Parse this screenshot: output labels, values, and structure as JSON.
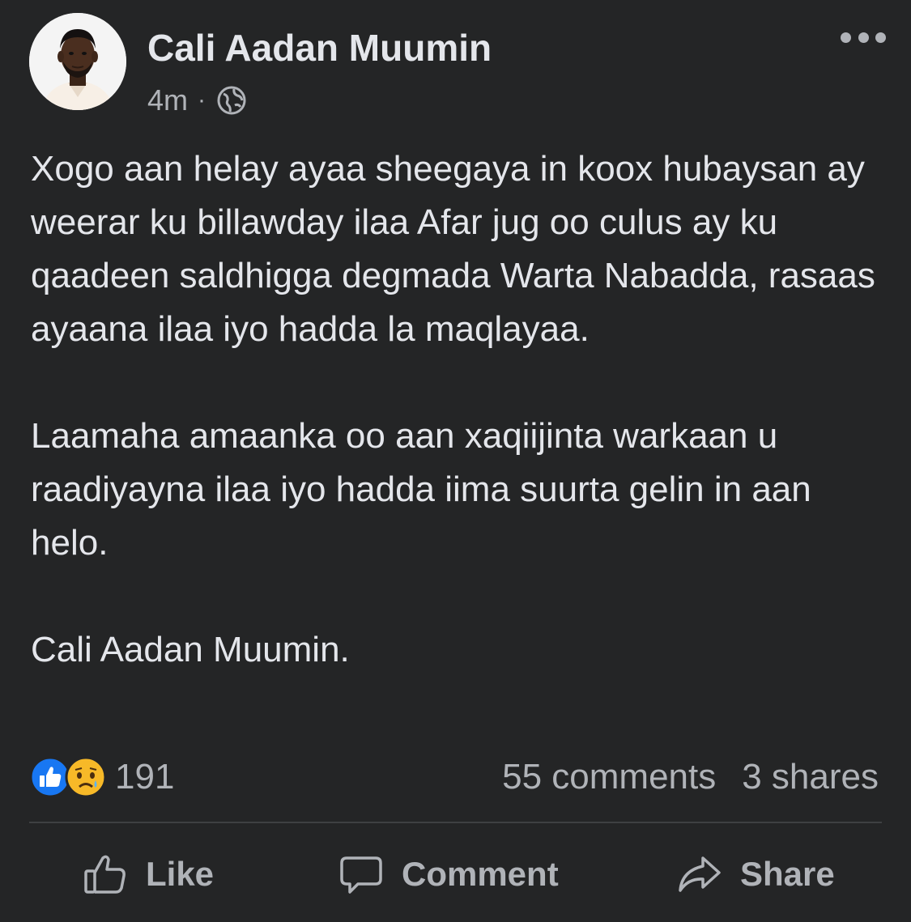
{
  "post": {
    "author": "Cali Aadan Muumin",
    "time": "4m",
    "separator": "·",
    "audience_icon": "globe-icon",
    "more_icon": "more-options-icon",
    "paragraphs": [
      "Xogo aan helay ayaa sheegaya in koox hubaysan ay weerar ku billawday ilaa Afar jug oo culus ay ku qaadeen saldhigga degmada Warta Nabadda, rasaas ayaana ilaa iyo hadda la maqlayaa.",
      "Laamaha amaanka oo aan xaqiijinta warkaan u raadiyayna ilaa iyo hadda iima suurta gelin in aan helo.",
      "Cali Aadan Muumin."
    ]
  },
  "stats": {
    "reaction_icons": [
      "like-reaction-icon",
      "sad-reaction-icon"
    ],
    "reaction_count": "191",
    "comments": "55 comments",
    "shares": "3 shares"
  },
  "actions": {
    "like": "Like",
    "comment": "Comment",
    "share": "Share"
  },
  "colors": {
    "background": "#242526",
    "primary_text": "#e4e6eb",
    "secondary_text": "#b0b3b8",
    "like_blue": "#1877f2",
    "sad_yellow": "#f7b928"
  }
}
